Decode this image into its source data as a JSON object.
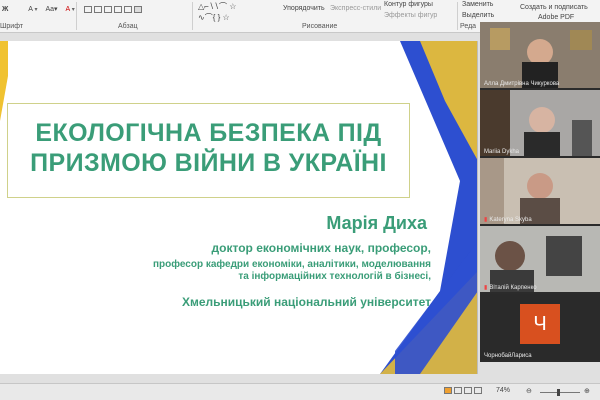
{
  "ribbon": {
    "font_size_label": "A",
    "font_group_label": "Шрифт",
    "paragraph_group_label": "Абзац",
    "arrange_label": "Упорядочить",
    "quick_styles_label": "Экспресс-стили",
    "shape_outline_label": "Контур фигуры",
    "shape_effects_label": "Эффекты фигур",
    "drawing_group_label": "Рисование",
    "replace_label": "Заменить",
    "select_label": "Выделить",
    "edit_group_label": "Реда",
    "create_pdf_label": "Создать и подписать",
    "adobe_pdf_label": "Adobe PDF"
  },
  "slide": {
    "title": "ЕКОЛОГІЧНА БЕЗПЕКА ПІД ПРИЗМОЮ ВІЙНИ В УКРАЇНІ",
    "author_name": "Марія Диха",
    "author_degree": "доктор економічних наук, професор,",
    "author_position_1": "професор кафедри економіки, аналітики, моделювання",
    "author_position_2": "та інформаційних технологій в бізнесі,",
    "author_university": "Хмельницький національний університет",
    "accent_color": "#3a9d78",
    "decor_blue": "#2d4fd0",
    "decor_yellow": "#f0c230"
  },
  "participants": [
    {
      "name": "Алла Дмитрівна Чикуркова",
      "muted": false
    },
    {
      "name": "Mariia Dykha",
      "muted": false
    },
    {
      "name": "Kateryna Skyba",
      "muted": true
    },
    {
      "name": "Віталій Карпенко",
      "muted": true
    },
    {
      "name": "ЧорнобайЛариса",
      "muted": false,
      "avatar_letter": "Ч",
      "avatar_color": "#d8501f"
    }
  ],
  "statusbar": {
    "zoom": "74%",
    "zoom_fraction": 0.45
  }
}
